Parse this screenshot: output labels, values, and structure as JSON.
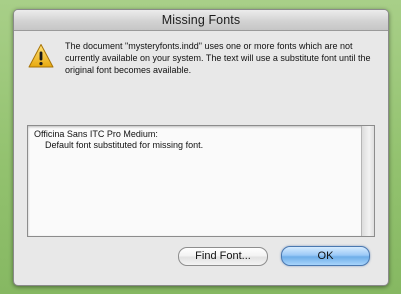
{
  "window": {
    "title": "Missing Fonts"
  },
  "alert": {
    "icon": "warning-icon",
    "message": "The document \"mysteryfonts.indd\" uses one or more fonts which are not currently available on your system. The text will use a substitute font until the original font becomes available."
  },
  "font_list": {
    "items": [
      {
        "name": "Officina Sans ITC Pro Medium:",
        "detail": "Default font substituted for missing font."
      }
    ]
  },
  "buttons": {
    "find_font": "Find Font...",
    "ok": "OK"
  },
  "colors": {
    "desktop": "#93c26f",
    "dialog": "#e8e8e8",
    "warning": "#f2c32b",
    "default_button": "#7db7ee"
  }
}
